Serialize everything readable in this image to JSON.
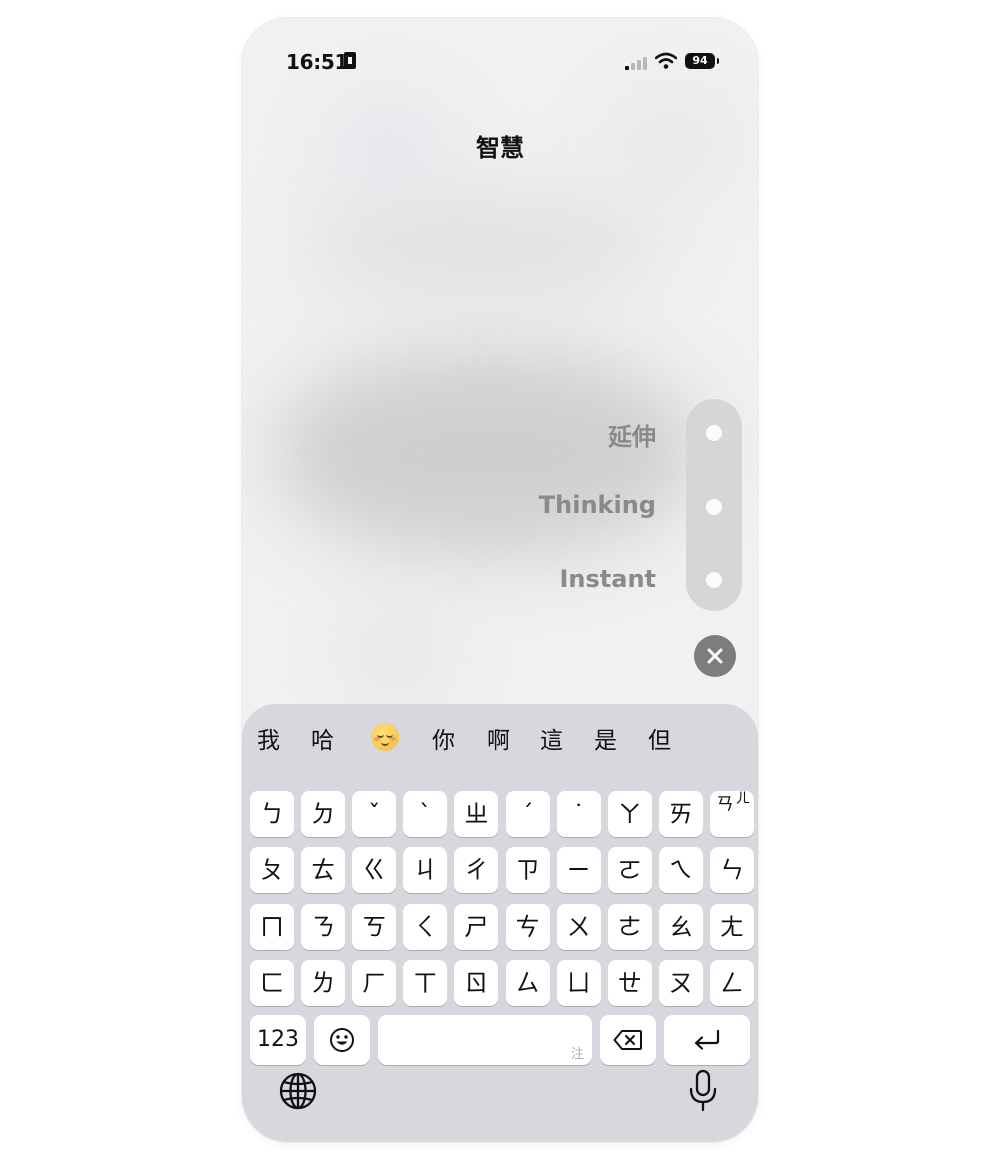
{
  "status_bar": {
    "time": "16:51",
    "battery": "94"
  },
  "header": {
    "title": "智慧"
  },
  "model_picker": {
    "options": [
      {
        "label": "延伸"
      },
      {
        "label": "Thinking"
      },
      {
        "label": "Instant"
      }
    ],
    "close_icon": "close-x-icon"
  },
  "keyboard": {
    "candidates": [
      "我",
      "哈",
      "😌",
      "你",
      "啊",
      "這",
      "是",
      "但"
    ],
    "rows": [
      [
        "ㄅ",
        "ㄉ",
        "ˇ",
        "ˋ",
        "ㄓ",
        "ˊ",
        "˙",
        "ㄚ",
        "ㄞ",
        "ㄢ"
      ],
      [
        "ㄆ",
        "ㄊ",
        "ㄍ",
        "ㄐ",
        "ㄔ",
        "ㄗ",
        "ㄧ",
        "ㄛ",
        "ㄟ",
        "ㄣ"
      ],
      [
        "ㄇ",
        "ㄋ",
        "ㄎ",
        "ㄑ",
        "ㄕ",
        "ㄘ",
        "ㄨ",
        "ㄜ",
        "ㄠ",
        "ㄤ"
      ],
      [
        "ㄈ",
        "ㄌ",
        "ㄏ",
        "ㄒ",
        "ㄖ",
        "ㄙ",
        "ㄩ",
        "ㄝ",
        "ㄡ",
        "ㄥ"
      ]
    ],
    "extra_key_small": "ㄦ",
    "numbers_label": "123",
    "space_hint": "注"
  }
}
